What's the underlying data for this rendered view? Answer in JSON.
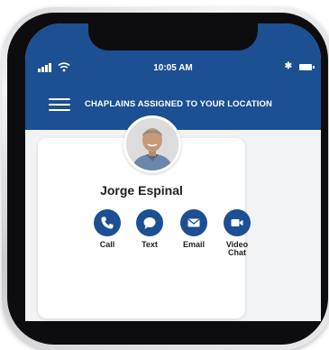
{
  "status_bar": {
    "time": "10:05 AM",
    "bluetooth_glyph": "✱"
  },
  "header": {
    "title": "CHAPLAINS ASSIGNED TO YOUR LOCATION"
  },
  "chaplain": {
    "name": "Jorge Espinal",
    "actions": [
      {
        "label": "Call",
        "icon": "phone-icon"
      },
      {
        "label": "Text",
        "icon": "chat-bubble-icon"
      },
      {
        "label": "Email",
        "icon": "mail-icon"
      },
      {
        "label": "Video\nChat",
        "icon": "video-camera-icon"
      }
    ]
  },
  "colors": {
    "brand_blue": "#1d4f93",
    "screen_bg": "#f2f3f5"
  }
}
